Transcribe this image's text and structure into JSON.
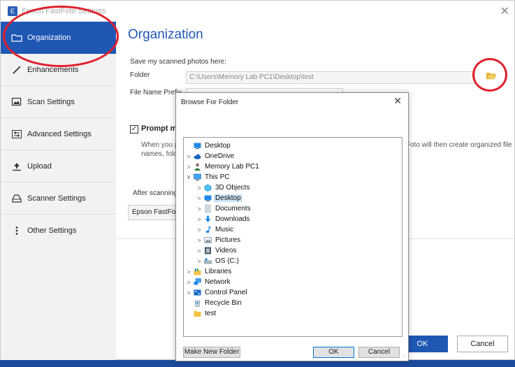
{
  "window": {
    "title": "Epson FastFoto Settings"
  },
  "sidebar": {
    "items": [
      {
        "label": "Organization",
        "icon": "folder-icon"
      },
      {
        "label": "Enhancements",
        "icon": "magic-wand-icon"
      },
      {
        "label": "Scan Settings",
        "icon": "scan-icon"
      },
      {
        "label": "Advanced Settings",
        "icon": "sliders-icon"
      },
      {
        "label": "Upload",
        "icon": "upload-icon"
      },
      {
        "label": "Scanner Settings",
        "icon": "scanner-icon"
      },
      {
        "label": "Other Settings",
        "icon": "more-vertical-icon"
      }
    ]
  },
  "main": {
    "title": "Organization",
    "save_heading": "Save my scanned photos here:",
    "folder_label": "Folder",
    "folder_value": "C:\\Users\\Memory Lab PC1\\Desktop\\test",
    "prefix_label": "File Name Prefix",
    "prompt_label": "Prompt me",
    "desc_left_1": "When you pr",
    "desc_left_2": "names, folde",
    "desc_right": "Foto will then create organized file",
    "after_label": "After scanning,",
    "epson_button": "Epson FastFoto",
    "ok": "OK",
    "cancel": "Cancel"
  },
  "dialog": {
    "title": "Browse For Folder",
    "tree": [
      {
        "label": "Desktop",
        "icon": "desktop-icon",
        "level": 0,
        "arrow": "",
        "selected": false
      },
      {
        "label": "OneDrive",
        "icon": "cloud-icon",
        "level": 1,
        "arrow": ">",
        "selected": false
      },
      {
        "label": "Memory Lab PC1",
        "icon": "user-icon",
        "level": 1,
        "arrow": ">",
        "selected": false
      },
      {
        "label": "This PC",
        "icon": "computer-icon",
        "level": 1,
        "arrow": "v",
        "selected": false
      },
      {
        "label": "3D Objects",
        "icon": "cube-icon",
        "level": 2,
        "arrow": ">",
        "selected": false
      },
      {
        "label": "Desktop",
        "icon": "desktop-icon",
        "level": 2,
        "arrow": ">",
        "selected": true
      },
      {
        "label": "Documents",
        "icon": "document-icon",
        "level": 2,
        "arrow": ">",
        "selected": false
      },
      {
        "label": "Downloads",
        "icon": "download-icon",
        "level": 2,
        "arrow": ">",
        "selected": false
      },
      {
        "label": "Music",
        "icon": "music-icon",
        "level": 2,
        "arrow": ">",
        "selected": false
      },
      {
        "label": "Pictures",
        "icon": "pictures-icon",
        "level": 2,
        "arrow": ">",
        "selected": false
      },
      {
        "label": "Videos",
        "icon": "video-icon",
        "level": 2,
        "arrow": ">",
        "selected": false
      },
      {
        "label": "OS (C:)",
        "icon": "drive-icon",
        "level": 2,
        "arrow": ">",
        "selected": false
      },
      {
        "label": "Libraries",
        "icon": "library-icon",
        "level": 1,
        "arrow": ">",
        "selected": false
      },
      {
        "label": "Network",
        "icon": "network-icon",
        "level": 1,
        "arrow": ">",
        "selected": false
      },
      {
        "label": "Control Panel",
        "icon": "control-panel-icon",
        "level": 1,
        "arrow": ">",
        "selected": false
      },
      {
        "label": "Recycle Bin",
        "icon": "recycle-bin-icon",
        "level": 1,
        "arrow": "",
        "selected": false
      },
      {
        "label": "test",
        "icon": "folder-icon",
        "level": 1,
        "arrow": "",
        "selected": false
      }
    ],
    "make_new_folder": "Make New Folder",
    "ok": "OK",
    "cancel": "Cancel"
  },
  "colors": {
    "accent": "#1f57b5",
    "annotation": "#e0202c",
    "selection": "#cce4f7"
  }
}
